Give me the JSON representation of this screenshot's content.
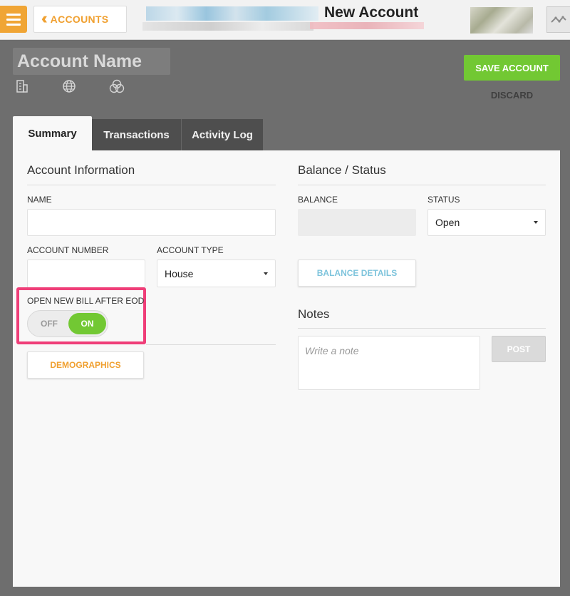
{
  "topbar": {
    "back_label": "ACCOUNTS",
    "title": "New Account",
    "icons": {
      "menu": "hamburger-menu-icon",
      "back": "double-chevron-left-icon",
      "activity": "activity-graph-icon"
    }
  },
  "header": {
    "account_name_placeholder": "Account Name",
    "icons": [
      "building-icon",
      "globe-icon",
      "circles-icon"
    ],
    "save_label": "SAVE ACCOUNT",
    "discard_label": "DISCARD"
  },
  "tabs": [
    {
      "label": "Summary",
      "active": true
    },
    {
      "label": "Transactions",
      "active": false
    },
    {
      "label": "Activity Log",
      "active": false
    }
  ],
  "account_info": {
    "title": "Account Information",
    "name_label": "NAME",
    "name_value": "",
    "number_label": "ACCOUNT NUMBER",
    "number_value": "",
    "type_label": "ACCOUNT TYPE",
    "type_value": "House",
    "open_bill_label": "OPEN NEW BILL AFTER EOD",
    "toggle_off": "OFF",
    "toggle_on": "ON",
    "demographics_label": "DEMOGRAPHICS"
  },
  "balance_status": {
    "title": "Balance / Status",
    "balance_label": "BALANCE",
    "status_label": "STATUS",
    "status_value": "Open",
    "details_label": "BALANCE DETAILS"
  },
  "notes": {
    "title": "Notes",
    "placeholder": "Write a note",
    "post_label": "POST"
  },
  "colors": {
    "accent_orange": "#f0a030",
    "save_green": "#72c833",
    "highlight_pink": "#ef3e78",
    "link_blue": "#7ec4dc",
    "page_grey": "#6e6e6e"
  }
}
